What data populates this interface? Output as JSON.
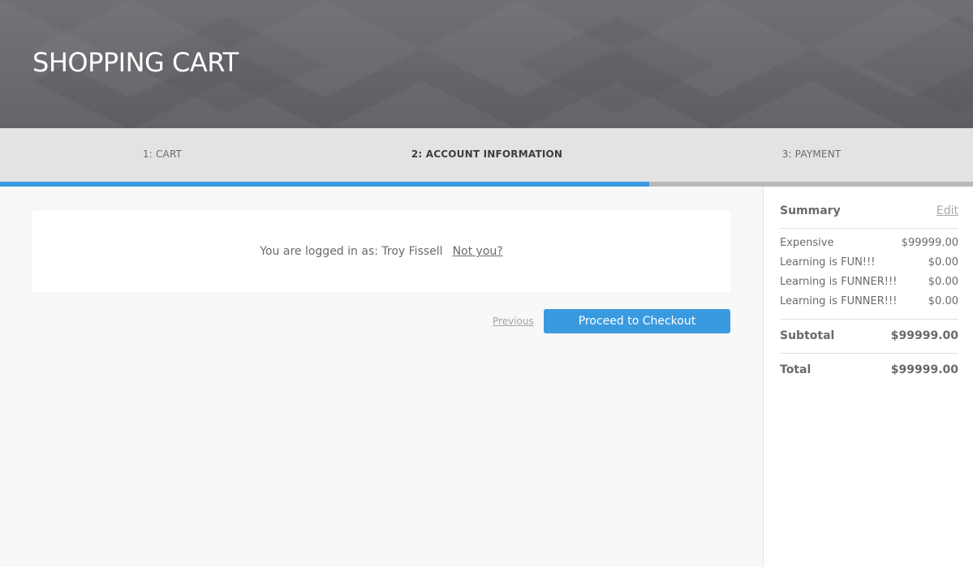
{
  "header": {
    "title": "SHOPPING CART"
  },
  "steps": [
    {
      "label": "1: CART",
      "active": false
    },
    {
      "label": "2: ACCOUNT INFORMATION",
      "active": true
    },
    {
      "label": "3: PAYMENT",
      "active": false
    }
  ],
  "progress": {
    "completed_fraction": 0.667
  },
  "account": {
    "logged_in_text": "You are logged in as: Troy Fissell",
    "not_you_link": "Not you?"
  },
  "actions": {
    "previous_label": "Previous",
    "checkout_label": "Proceed to Checkout"
  },
  "summary": {
    "title": "Summary",
    "edit_label": "Edit",
    "items": [
      {
        "name": "Expensive",
        "price": "$99999.00"
      },
      {
        "name": "Learning is FUN!!!",
        "price": "$0.00"
      },
      {
        "name": "Learning is FUNNER!!!",
        "price": "$0.00"
      },
      {
        "name": "Learning is FUNNER!!!",
        "price": "$0.00"
      }
    ],
    "subtotal_label": "Subtotal",
    "subtotal_value": "$99999.00",
    "total_label": "Total",
    "total_value": "$99999.00"
  },
  "colors": {
    "accent": "#3a9ae0",
    "header_bg": "#646669",
    "steps_bg": "#e3e3e3"
  }
}
